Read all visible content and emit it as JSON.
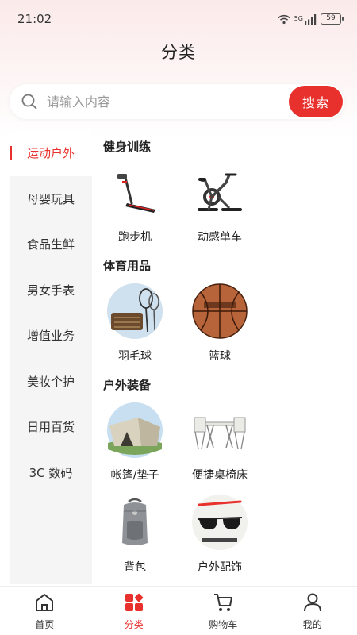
{
  "status_bar": {
    "time": "21:02",
    "network": "5G",
    "battery": "59"
  },
  "page": {
    "title": "分类"
  },
  "search": {
    "placeholder": "请输入内容",
    "button_label": "搜索"
  },
  "sidebar": {
    "items": [
      {
        "label": "运动户外",
        "active": true
      },
      {
        "label": "母婴玩具"
      },
      {
        "label": "食品生鲜"
      },
      {
        "label": "男女手表"
      },
      {
        "label": "增值业务"
      },
      {
        "label": "美妆个护"
      },
      {
        "label": "日用百货"
      },
      {
        "label": "3C 数码"
      }
    ]
  },
  "sections": [
    {
      "title": "健身训练",
      "items": [
        {
          "label": "跑步机",
          "icon": "treadmill-image"
        },
        {
          "label": "动感单车",
          "icon": "spin-bike-image"
        }
      ]
    },
    {
      "title": "体育用品",
      "items": [
        {
          "label": "羽毛球",
          "icon": "badminton-image"
        },
        {
          "label": "篮球",
          "icon": "basketball-image"
        }
      ]
    },
    {
      "title": "户外装备",
      "items": [
        {
          "label": "帐篷/垫子",
          "icon": "tent-image"
        },
        {
          "label": "便捷桌椅床",
          "icon": "folding-table-image"
        },
        {
          "label": "背包",
          "icon": "backpack-image"
        },
        {
          "label": "户外配饰",
          "icon": "sunglasses-image"
        }
      ]
    }
  ],
  "tabbar": {
    "items": [
      {
        "label": "首页",
        "icon": "home-icon"
      },
      {
        "label": "分类",
        "icon": "category-icon",
        "active": true
      },
      {
        "label": "购物车",
        "icon": "cart-icon"
      },
      {
        "label": "我的",
        "icon": "profile-icon"
      }
    ]
  },
  "colors": {
    "accent": "#e8312d",
    "sidebar_bg": "#f5f5f5",
    "top_gradient": "#fbeaea"
  }
}
